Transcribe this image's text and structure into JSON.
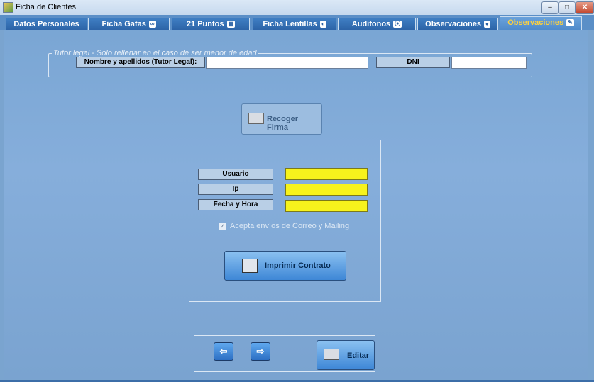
{
  "window": {
    "title": "Ficha de Clientes",
    "minimize": "–",
    "maximize": "□",
    "close": "✕"
  },
  "tabs": [
    {
      "label": "Datos Personales",
      "icon": ""
    },
    {
      "label": "Ficha Gafas",
      "icon": "∞"
    },
    {
      "label": "21 Puntos",
      "icon": "▦"
    },
    {
      "label": "Ficha Lentillas",
      "icon": "◐"
    },
    {
      "label": "Audífonos",
      "icon": "⦿"
    },
    {
      "label": "Observaciones",
      "icon": "●"
    },
    {
      "label": "Observaciones",
      "icon": "✎"
    }
  ],
  "active_tab": 6,
  "tutor": {
    "legend": "Tutor legal - Solo rellenar en el caso de ser menor de edad",
    "name_label": "Nombre y apellidos (Tutor Legal):",
    "name_value": "",
    "dni_label": "DNI",
    "dni_value": ""
  },
  "firma_button": {
    "label": "Recoger Firma",
    "icon": "keyboard-icon"
  },
  "info": {
    "usuario_label": "Usuario",
    "usuario_value": "",
    "ip_label": "Ip",
    "ip_value": "",
    "fecha_label": "Fecha y Hora",
    "fecha_value": ""
  },
  "checkbox": {
    "label": "Acepta envíos de Correo y Mailing",
    "checked": true
  },
  "print_button": {
    "label": "Imprimir Contrato",
    "icon": "printer-icon"
  },
  "nav": {
    "prev": "⇦",
    "next": "⇨"
  },
  "edit_button": {
    "label": "Editar",
    "icon": "keyboard-icon"
  },
  "colors": {
    "accent_active_tab": "#ffd23c",
    "highlight_field": "#f7f31c"
  }
}
